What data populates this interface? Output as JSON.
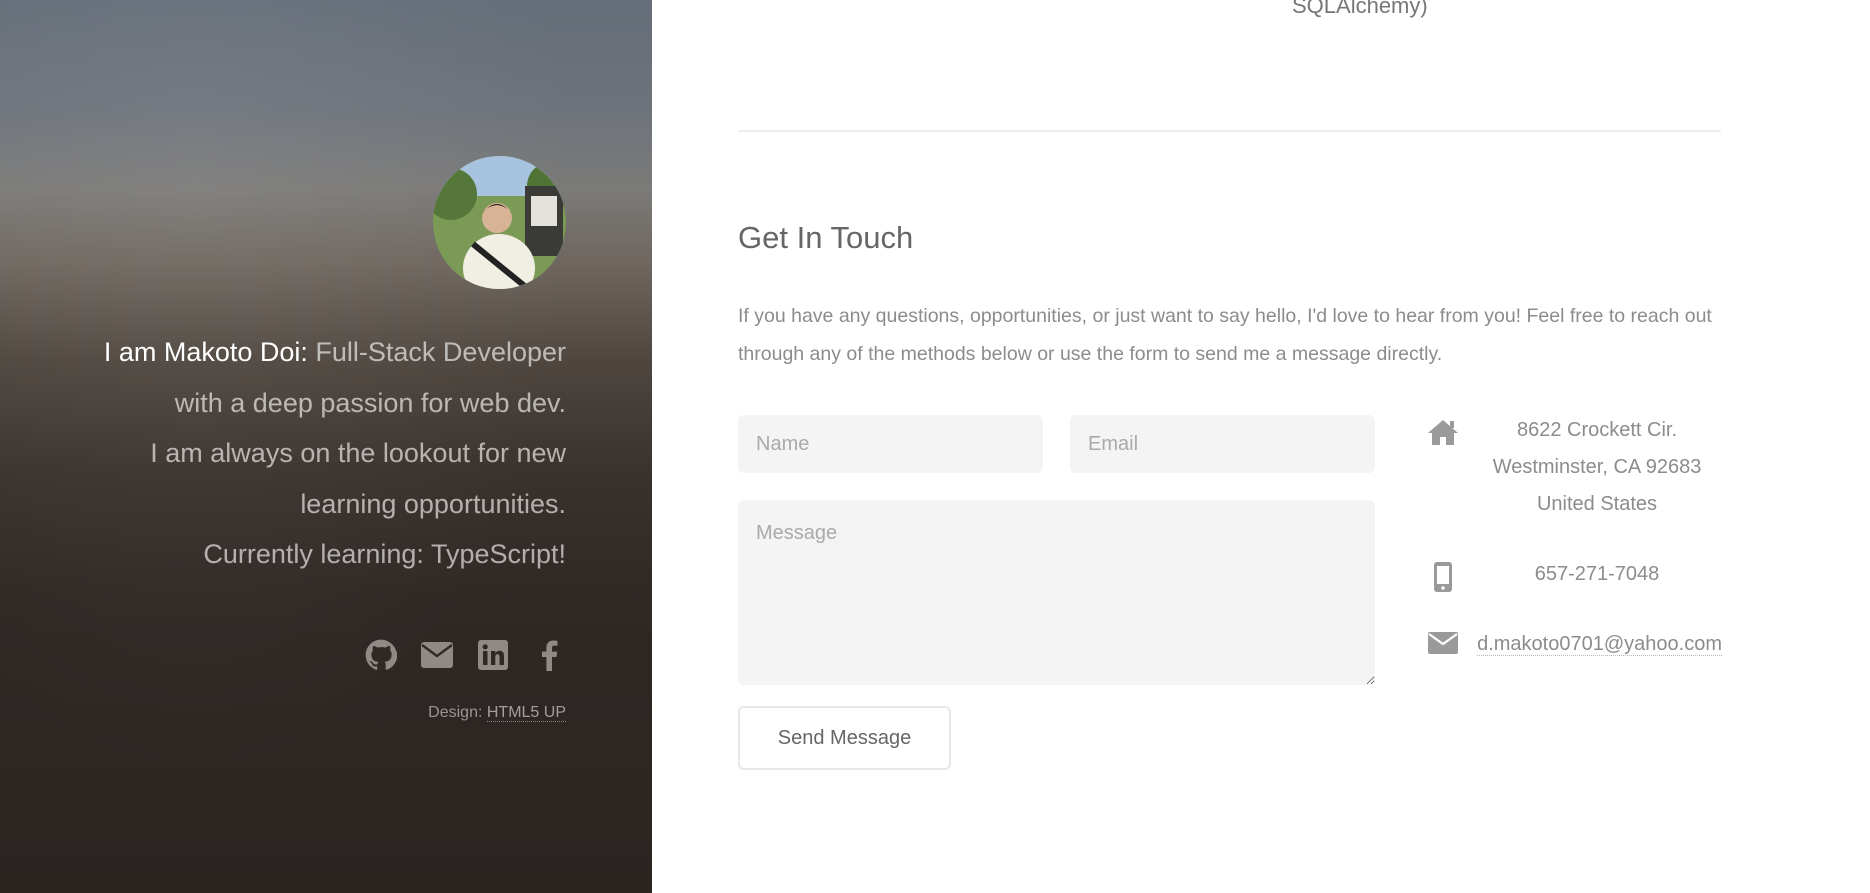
{
  "sidebar": {
    "intro": {
      "name": "I am Makoto Doi:",
      "role": "Full-Stack Developer",
      "line2": "with a deep passion for web dev.",
      "line3": "I am always on the lookout for new",
      "line4": "learning opportunities.",
      "line5": "Currently learning: TypeScript!"
    },
    "socials": [
      {
        "icon": "github-icon"
      },
      {
        "icon": "envelope-icon"
      },
      {
        "icon": "linkedin-icon"
      },
      {
        "icon": "facebook-icon"
      }
    ],
    "credit": {
      "prefix": "Design:",
      "link_label": "HTML5 UP"
    }
  },
  "previous_section": {
    "tail_text": "SQLAlchemy)"
  },
  "contact_section": {
    "title": "Get In Touch",
    "description": "If you have any questions, opportunities, or just want to say hello, I'd love to hear from you! Feel free to reach out through any of the methods below or use the form to send me a message directly.",
    "form": {
      "name_placeholder": "Name",
      "email_placeholder": "Email",
      "message_placeholder": "Message",
      "submit_label": "Send Message"
    },
    "details": {
      "address_line1": "8622 Crockett Cir.",
      "address_line2": "Westminster, CA 92683",
      "address_line3": "United States",
      "phone": "657-271-7048",
      "email": "d.makoto0701@yahoo.com"
    }
  },
  "colors": {
    "icon_gray": "#9a9a9a",
    "sidebar_icon": "#8f8a86"
  }
}
